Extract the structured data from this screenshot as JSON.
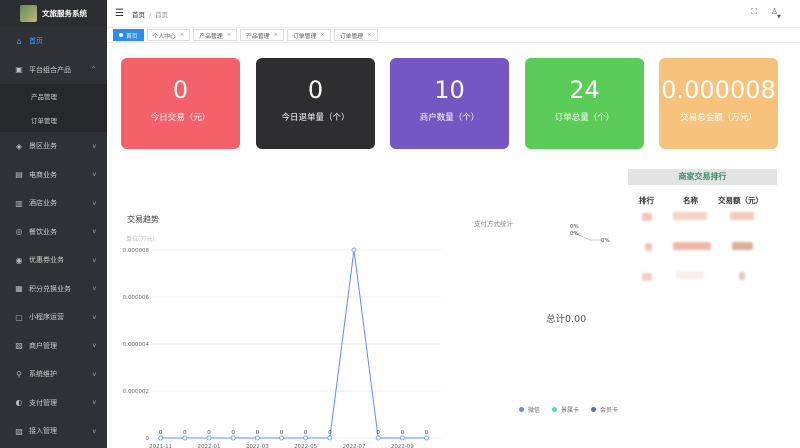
{
  "app": {
    "title": "文旅服务系统"
  },
  "sidebar": {
    "items": [
      {
        "label": "首页",
        "icon": "home-icon",
        "glyph": "⌂",
        "active": true,
        "chevron": ""
      },
      {
        "label": "平台组合产品",
        "icon": "gift-icon",
        "glyph": "▣",
        "chevron": "^"
      },
      {
        "label": "景区业务",
        "icon": "scenic-icon",
        "glyph": "◈",
        "chevron": "v"
      },
      {
        "label": "电商业务",
        "icon": "shop-icon",
        "glyph": "▤",
        "chevron": "v"
      },
      {
        "label": "酒店业务",
        "icon": "hotel-icon",
        "glyph": "▥",
        "chevron": "v"
      },
      {
        "label": "餐饮业务",
        "icon": "food-icon",
        "glyph": "◎",
        "chevron": "v"
      },
      {
        "label": "优惠券业务",
        "icon": "coupon-icon",
        "glyph": "◉",
        "chevron": "v"
      },
      {
        "label": "积分兑换业务",
        "icon": "points-icon",
        "glyph": "▦",
        "chevron": "v"
      },
      {
        "label": "小程序运营",
        "icon": "miniapp-icon",
        "glyph": "▢",
        "chevron": "v"
      },
      {
        "label": "商户管理",
        "icon": "merchant-icon",
        "glyph": "▧",
        "chevron": "v"
      },
      {
        "label": "系统维护",
        "icon": "maintenance-icon",
        "glyph": "⚲",
        "chevron": "v"
      },
      {
        "label": "支付管理",
        "icon": "payment-icon",
        "glyph": "◐",
        "chevron": "v"
      },
      {
        "label": "接入管理",
        "icon": "access-icon",
        "glyph": "▨",
        "chevron": "v"
      }
    ],
    "sub_items": [
      "产品管理",
      "订单管理"
    ]
  },
  "header": {
    "breadcrumb": [
      "首页",
      "首页"
    ],
    "icons": [
      "fullscreen-icon",
      "notification-icon"
    ]
  },
  "tags": [
    {
      "label": "首页",
      "active": true
    },
    {
      "label": "个人中心"
    },
    {
      "label": "产品管理"
    },
    {
      "label": "产品管理"
    },
    {
      "label": "订单管理"
    },
    {
      "label": "订单管理"
    }
  ],
  "cards": [
    {
      "value": "0",
      "label": "今日交易（元）",
      "color": "#f5616a"
    },
    {
      "value": "0",
      "label": "今日退单量（个）",
      "color": "#2e2e31"
    },
    {
      "value": "10",
      "label": "商户数量（个）",
      "color": "#7457c3"
    },
    {
      "value": "24",
      "label": "订单总量（个）",
      "color": "#5bcc58"
    },
    {
      "value": "0.000008",
      "label": "交易总金额（万元）",
      "color": "#f6c27c"
    }
  ],
  "trend": {
    "title": "交易趋势",
    "unit": "单位(万元)"
  },
  "chart_data": [
    {
      "type": "line",
      "title": "交易趋势",
      "ylabel": "单位(万元)",
      "x": [
        "2021-11",
        "2021-12",
        "2022-01",
        "2022-02",
        "2022-03",
        "2022-04",
        "2022-05",
        "2022-06",
        "2022-07",
        "2022-08",
        "2022-09",
        "2022-10"
      ],
      "x_tick_labels": [
        "2021-11",
        "2022-01",
        "2022-03",
        "2022-05",
        "2022-07",
        "2022-09"
      ],
      "values": [
        0,
        0,
        0,
        0,
        0,
        0,
        0,
        0,
        8e-06,
        0,
        0,
        0
      ],
      "point_labels": [
        "0",
        "0",
        "0",
        "0",
        "0",
        "0",
        "0",
        "0",
        "",
        "0",
        "0",
        "0"
      ],
      "y_tick_labels": [
        "0.000008",
        "0.000006",
        "0.000004",
        "0.000002",
        "0"
      ],
      "ylim": [
        0,
        8e-06
      ],
      "grid": true,
      "color": "#5b8ff9"
    },
    {
      "type": "pie",
      "title": "支付方式统计",
      "total_label": "总计0.00",
      "series": [
        {
          "name": "微信",
          "value": 0,
          "label": "0%",
          "color": "#5b8ff9"
        },
        {
          "name": "景属卡",
          "value": 0,
          "label": "0%",
          "color": "#5ad8a6"
        },
        {
          "name": "会员卡",
          "value": 0,
          "label": "0%",
          "color": "#5d7092"
        }
      ]
    }
  ],
  "ranking": {
    "title": "商家交易排行",
    "headers": [
      "排行",
      "名称",
      "交易额（元）"
    ]
  }
}
